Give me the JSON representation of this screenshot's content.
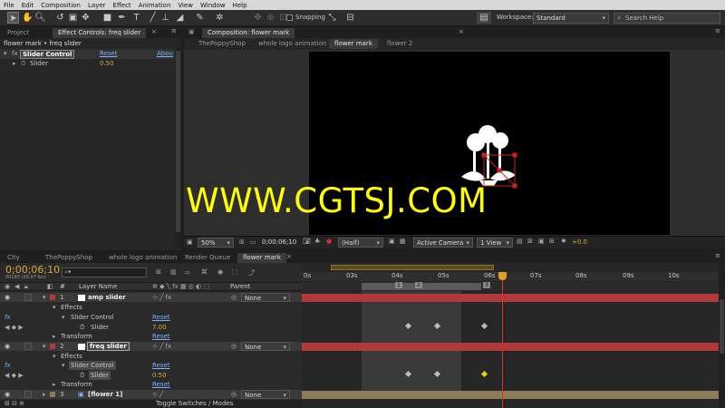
{
  "menu": [
    "File",
    "Edit",
    "Composition",
    "Layer",
    "Effect",
    "Animation",
    "View",
    "Window",
    "Help"
  ],
  "toolbar": {
    "snapping_label": "Snapping",
    "workspace_label": "Workspace:",
    "workspace_value": "Standard",
    "search_placeholder": "Search Help"
  },
  "left_panel": {
    "tab_project": "Project",
    "tab_effect_controls": "Effect Controls: freq slider",
    "breadcrumb": "flower mark • freq slider",
    "effect_name": "Slider Control",
    "reset": "Reset",
    "about": "Abou",
    "property": "Slider",
    "value": "0.50"
  },
  "comp_panel": {
    "tab_title": "Composition: flower mark",
    "nav": [
      "ThePoppyShop",
      "whole logo animation",
      "flower mark",
      "flower 2"
    ]
  },
  "watermark": "WWW.CGTSJ.COM",
  "viewer_bar": {
    "zoom": "50%",
    "timecode": "0;00;06;10",
    "resolution": "(Half)",
    "camera": "Active Camera",
    "view": "1 View",
    "exposure": "+0.0"
  },
  "timeline": {
    "tabs": [
      "City",
      "ThePoppyShop",
      "whole logo animation",
      "Render Queue",
      "flower mark"
    ],
    "timecode": "0;00;06;10",
    "frame_info": "00190 (29.97 fps)",
    "search_placeholder": "",
    "col_hash": "#",
    "col_layer_name": "Layer Name",
    "col_parent": "Parent",
    "toggle_label": "Toggle Switches / Modes",
    "ruler": [
      "0s",
      "03s",
      "04s",
      "05s",
      "06s",
      "07s",
      "08s",
      "09s",
      "10s"
    ],
    "markers": [
      "1",
      "2",
      "3"
    ],
    "layers": [
      {
        "num": "1",
        "name": "amp slider",
        "parent": "None",
        "effects": "Effects",
        "effect": "Slider Control",
        "reset": "Reset",
        "slider": "Slider",
        "slider_value": "7.00",
        "transform": "Transform",
        "transform_reset": "Reset",
        "fx": "fx"
      },
      {
        "num": "2",
        "name": "freq slider",
        "parent": "None",
        "effects": "Effects",
        "effect": "Slider Control",
        "reset": "Reset",
        "slider": "Slider",
        "slider_value": "0.50",
        "transform": "Transform",
        "transform_reset": "Reset",
        "fx": "fx"
      },
      {
        "num": "3",
        "name": "[flower 1]",
        "parent": "None"
      }
    ],
    "colors": {
      "layer_bar": "#b03a3a",
      "layer3_bar": "#8c7a58",
      "playhead": "#e0302a"
    }
  }
}
